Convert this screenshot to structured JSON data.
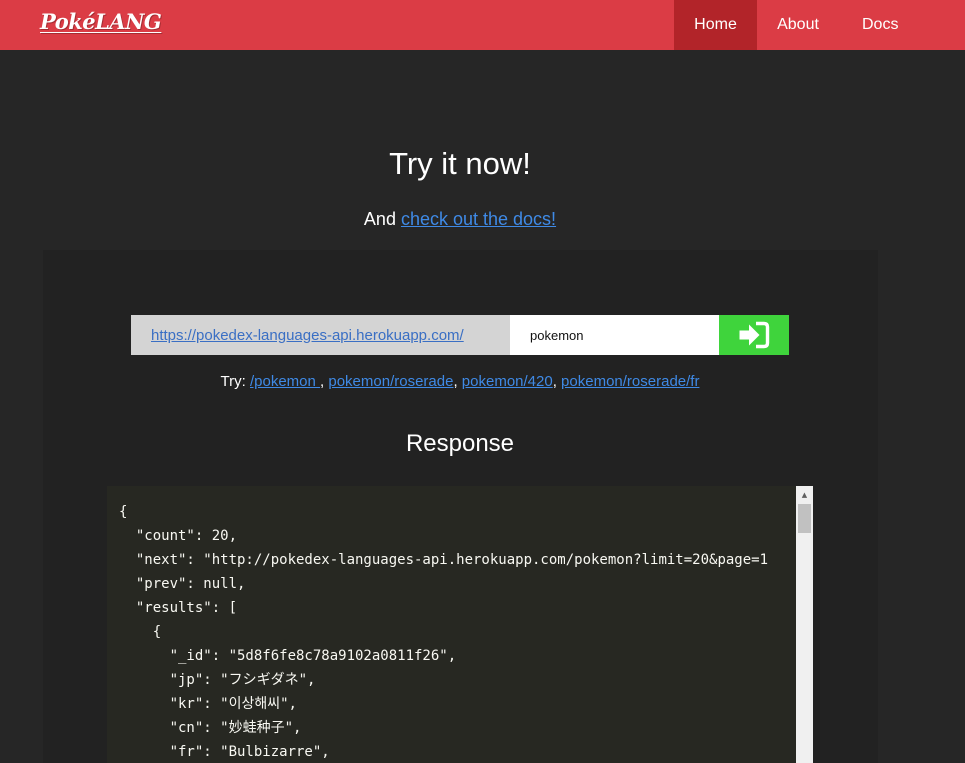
{
  "navbar": {
    "brand": "PokéLANG",
    "items": [
      {
        "label": "Home",
        "active": true
      },
      {
        "label": "About",
        "active": false
      },
      {
        "label": "Docs",
        "active": false
      }
    ],
    "bg_color": "#db3c45",
    "active_color": "#b22429"
  },
  "hero": {
    "title": "Try it now!",
    "subtitle_prefix": "And",
    "docs_link": "check out the docs!"
  },
  "request": {
    "base_url": "https://pokedex-languages-api.herokuapp.com/",
    "path_value": "pokemon",
    "submit_icon": "sign-in-arrow-icon",
    "submit_color": "#3fd43c"
  },
  "try": {
    "label": "Try:",
    "links": [
      "/pokemon ",
      "pokemon/roserade",
      "pokemon/420",
      "pokemon/roserade/fr"
    ]
  },
  "response": {
    "title": "Response",
    "lines": [
      "{",
      "  \"count\": 20,",
      "  \"next\": \"http://pokedex-languages-api.herokuapp.com/pokemon?limit=20&page=1",
      "  \"prev\": null,",
      "  \"results\": [",
      "    {",
      "      \"_id\": \"5d8f6fe8c78a9102a0811f26\",",
      "      \"jp\": \"フシギダネ\",",
      "      \"kr\": \"이상해씨\",",
      "      \"cn\": \"妙蛙种子\",",
      "      \"fr\": \"Bulbizarre\","
    ]
  }
}
